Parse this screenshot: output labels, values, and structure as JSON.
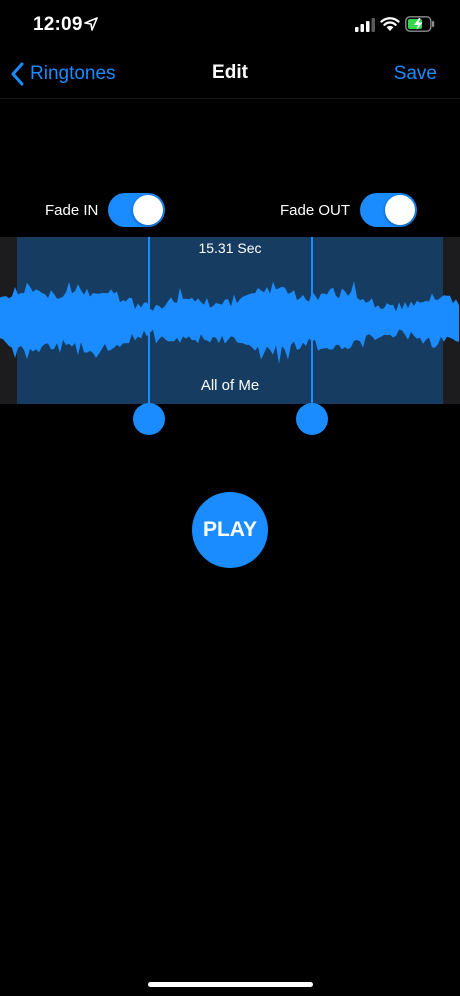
{
  "status_bar": {
    "time": "12:09",
    "icons": [
      "location-arrow-icon",
      "cellular-signal-icon",
      "wifi-icon",
      "battery-charging-icon"
    ]
  },
  "nav": {
    "back_label": "Ringtones",
    "title": "Edit",
    "save_label": "Save"
  },
  "fade": {
    "in_label": "Fade IN",
    "in_on": true,
    "out_label": "Fade OUT",
    "out_on": true
  },
  "waveform": {
    "duration": "15.31 Sec",
    "song_title": "All of Me"
  },
  "play_label": "PLAY",
  "colors": {
    "accent": "#1a8cff",
    "background": "#000000",
    "selection": "#173c61"
  }
}
